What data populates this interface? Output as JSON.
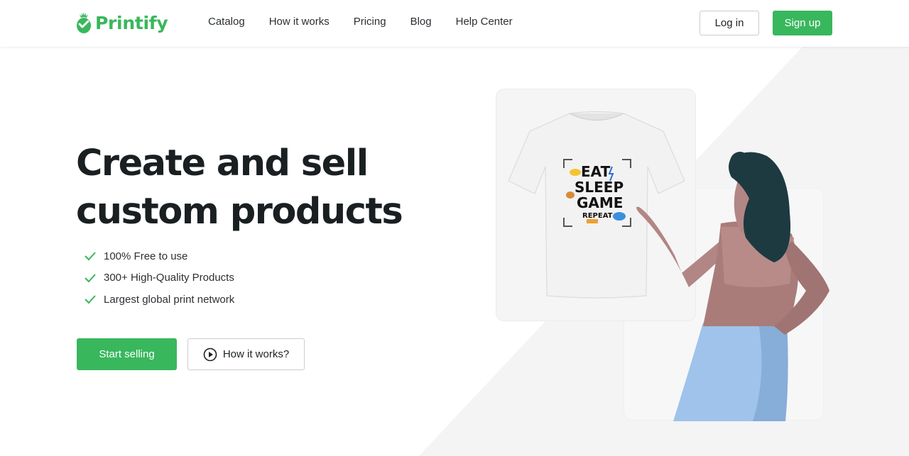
{
  "brand": {
    "name": "Printify",
    "color": "#39b75d"
  },
  "nav": {
    "items": [
      "Catalog",
      "How it works",
      "Pricing",
      "Blog",
      "Help Center"
    ]
  },
  "auth": {
    "login_label": "Log in",
    "signup_label": "Sign up"
  },
  "hero": {
    "title_line1": "Create and sell",
    "title_line2": "custom products",
    "features": [
      "100% Free to use",
      "300+ High-Quality Products",
      "Largest global print network"
    ],
    "primary_cta": "Start selling",
    "secondary_cta": "How it works?"
  },
  "illustration": {
    "shirt_print": [
      "EAT",
      "SLEEP",
      "GAME",
      "REPEAT"
    ]
  }
}
